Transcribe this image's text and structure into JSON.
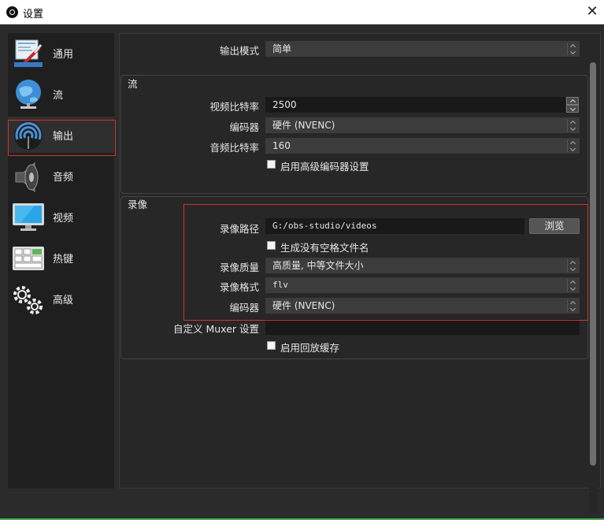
{
  "window": {
    "title": "设置",
    "close": "✕"
  },
  "sidebar": {
    "items": [
      {
        "label": "通用",
        "icon": "general-icon"
      },
      {
        "label": "流",
        "icon": "stream-icon"
      },
      {
        "label": "输出",
        "icon": "output-icon",
        "selected": true
      },
      {
        "label": "音频",
        "icon": "audio-icon"
      },
      {
        "label": "视频",
        "icon": "video-icon"
      },
      {
        "label": "热键",
        "icon": "hotkeys-icon"
      },
      {
        "label": "高级",
        "icon": "advanced-icon"
      }
    ]
  },
  "output": {
    "mode_label": "输出模式",
    "mode_value": "简单",
    "streaming": {
      "title": "流",
      "video_bitrate_label": "视频比特率",
      "video_bitrate_value": "2500",
      "encoder_label": "编码器",
      "encoder_value": "硬件 (NVENC)",
      "audio_bitrate_label": "音频比特率",
      "audio_bitrate_value": "160",
      "advanced_encoder_label": "启用高级编码器设置",
      "advanced_encoder_checked": false
    },
    "recording": {
      "title": "录像",
      "path_label": "录像路径",
      "path_value": "G:/obs-studio/videos",
      "browse_label": "浏览",
      "no_space_label": "生成没有空格文件名",
      "no_space_checked": false,
      "quality_label": "录像质量",
      "quality_value": "高质量, 中等文件大小",
      "format_label": "录像格式",
      "format_value": "flv",
      "encoder_label": "编码器",
      "encoder_value": "硬件 (NVENC)",
      "muxer_label": "自定义 Muxer 设置",
      "muxer_value": "",
      "replay_buffer_label": "启用回放缓存",
      "replay_buffer_checked": false
    }
  },
  "colors": {
    "highlight_border": "#d0342c",
    "background": "#2b2b2b",
    "accent_bottom": "#4caf50"
  }
}
